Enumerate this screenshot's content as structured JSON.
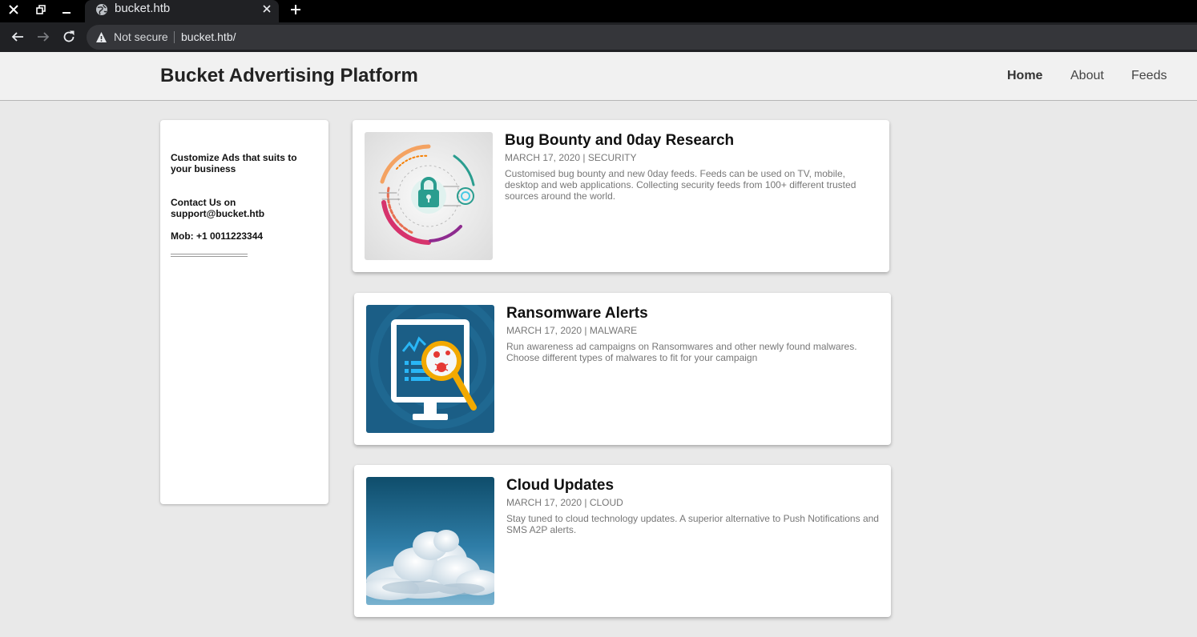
{
  "browser": {
    "tab_title": "bucket.htb",
    "security_label": "Not secure",
    "url": "bucket.htb/"
  },
  "header": {
    "brand": "Bucket Advertising Platform",
    "nav": [
      {
        "label": "Home",
        "active": true
      },
      {
        "label": "About",
        "active": false
      },
      {
        "label": "Feeds",
        "active": false
      }
    ]
  },
  "sidebar": {
    "tagline": "Customize Ads that suits to your business",
    "contact": "Contact Us on support@bucket.htb",
    "mobile": "Mob: +1 0011223344"
  },
  "posts": [
    {
      "title": "Bug Bounty and 0day Research",
      "meta": "MARCH 17, 2020 | SECURITY",
      "body": "Customised bug bounty and new 0day feeds. Feeds can be used on TV, mobile, desktop and web applications. Collecting security feeds from 100+ different trusted sources around the world.",
      "image": "security-lock-illustration"
    },
    {
      "title": "Ransomware Alerts",
      "meta": "MARCH 17, 2020 | MALWARE",
      "body": "Run awareness ad campaigns on Ransomwares and other newly found malwares. Choose different types of malwares to fit for your campaign",
      "image": "malware-monitor-illustration"
    },
    {
      "title": "Cloud Updates",
      "meta": "MARCH 17, 2020 | CLOUD",
      "body": "Stay tuned to cloud technology updates. A superior alternative to Push Notifications and SMS A2P alerts.",
      "image": "cloud-photo"
    }
  ]
}
